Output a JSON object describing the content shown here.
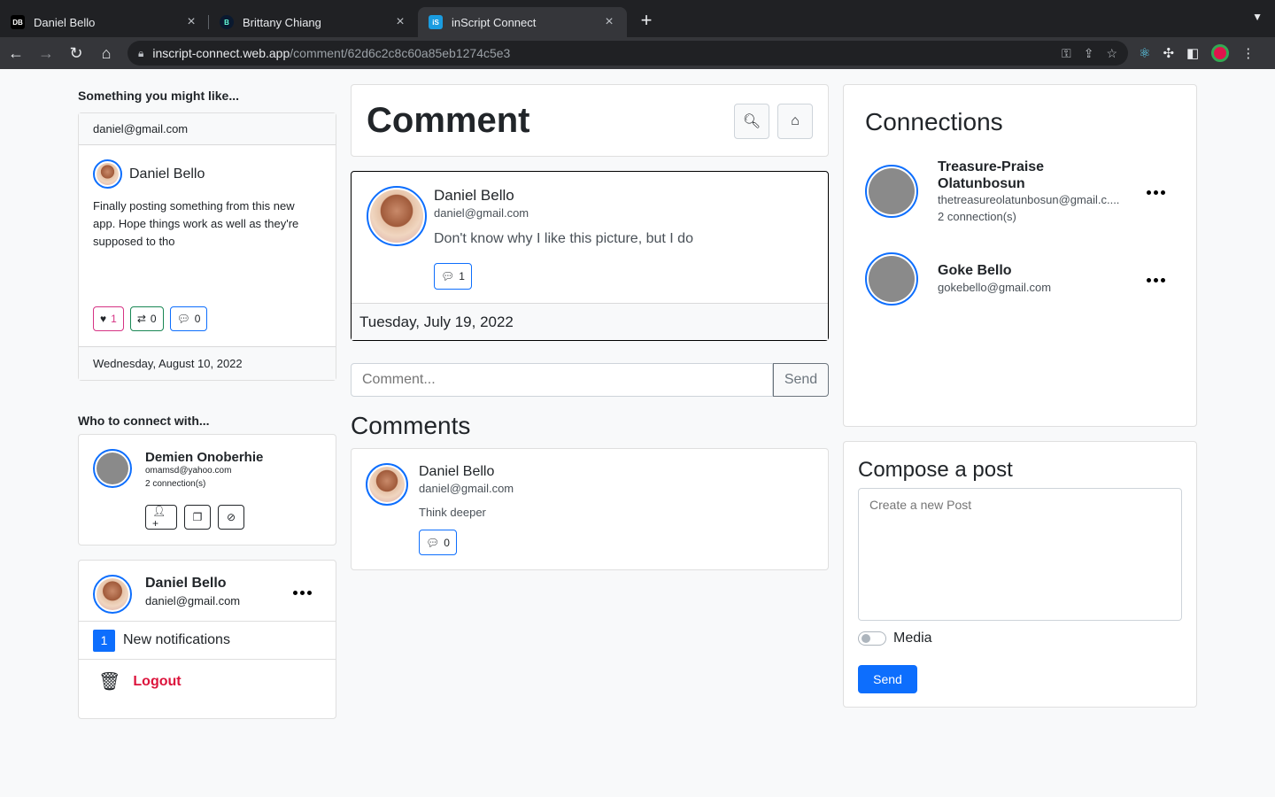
{
  "browser": {
    "tabs": [
      {
        "title": "Daniel Bello",
        "favicon": "DB"
      },
      {
        "title": "Brittany Chiang",
        "favicon": "B"
      },
      {
        "title": "inScript Connect",
        "favicon": "iS"
      }
    ],
    "url_host": "inscript-connect.web.app",
    "url_path": "/comment/62d6c2c8c60a85eb1274c5e3"
  },
  "left": {
    "suggest_heading": "Something you might like...",
    "suggest_post": {
      "header_email": "daniel@gmail.com",
      "author": "Daniel Bello",
      "text": "Finally posting something from this new app. Hope things work as well as they're supposed to tho",
      "likes": "1",
      "reposts": "0",
      "comments": "0",
      "date": "Wednesday, August 10, 2022"
    },
    "connect_heading": "Who to connect with...",
    "connect_user": {
      "name": "Demien Onoberhie",
      "email": "omamsd@yahoo.com",
      "connections": "2 connection(s)"
    },
    "me": {
      "name": "Daniel Bello",
      "email": "daniel@gmail.com",
      "notif_count": "1",
      "notif_label": "New notifications",
      "logout": "Logout"
    }
  },
  "center": {
    "title": "Comment",
    "post": {
      "author": "Daniel Bello",
      "email": "daniel@gmail.com",
      "text": "Don't know why I like this picture, but I do",
      "comments": "1",
      "date": "Tuesday, July 19, 2022"
    },
    "comment_input": {
      "placeholder": "Comment...",
      "send": "Send"
    },
    "comments_heading": "Comments",
    "comments": [
      {
        "author": "Daniel Bello",
        "email": "daniel@gmail.com",
        "text": "Think deeper",
        "replies": "0"
      }
    ]
  },
  "right": {
    "connections_title": "Connections",
    "connections": [
      {
        "name": "Treasure-Praise Olatunbosun",
        "email": "thetreasureolatunbosun@gmail.c....",
        "count": "2 connection(s)"
      },
      {
        "name": "Goke Bello",
        "email": "gokebello@gmail.com",
        "count": ""
      }
    ],
    "compose": {
      "title": "Compose a post",
      "placeholder": "Create a new Post",
      "media_label": "Media",
      "send": "Send"
    }
  }
}
